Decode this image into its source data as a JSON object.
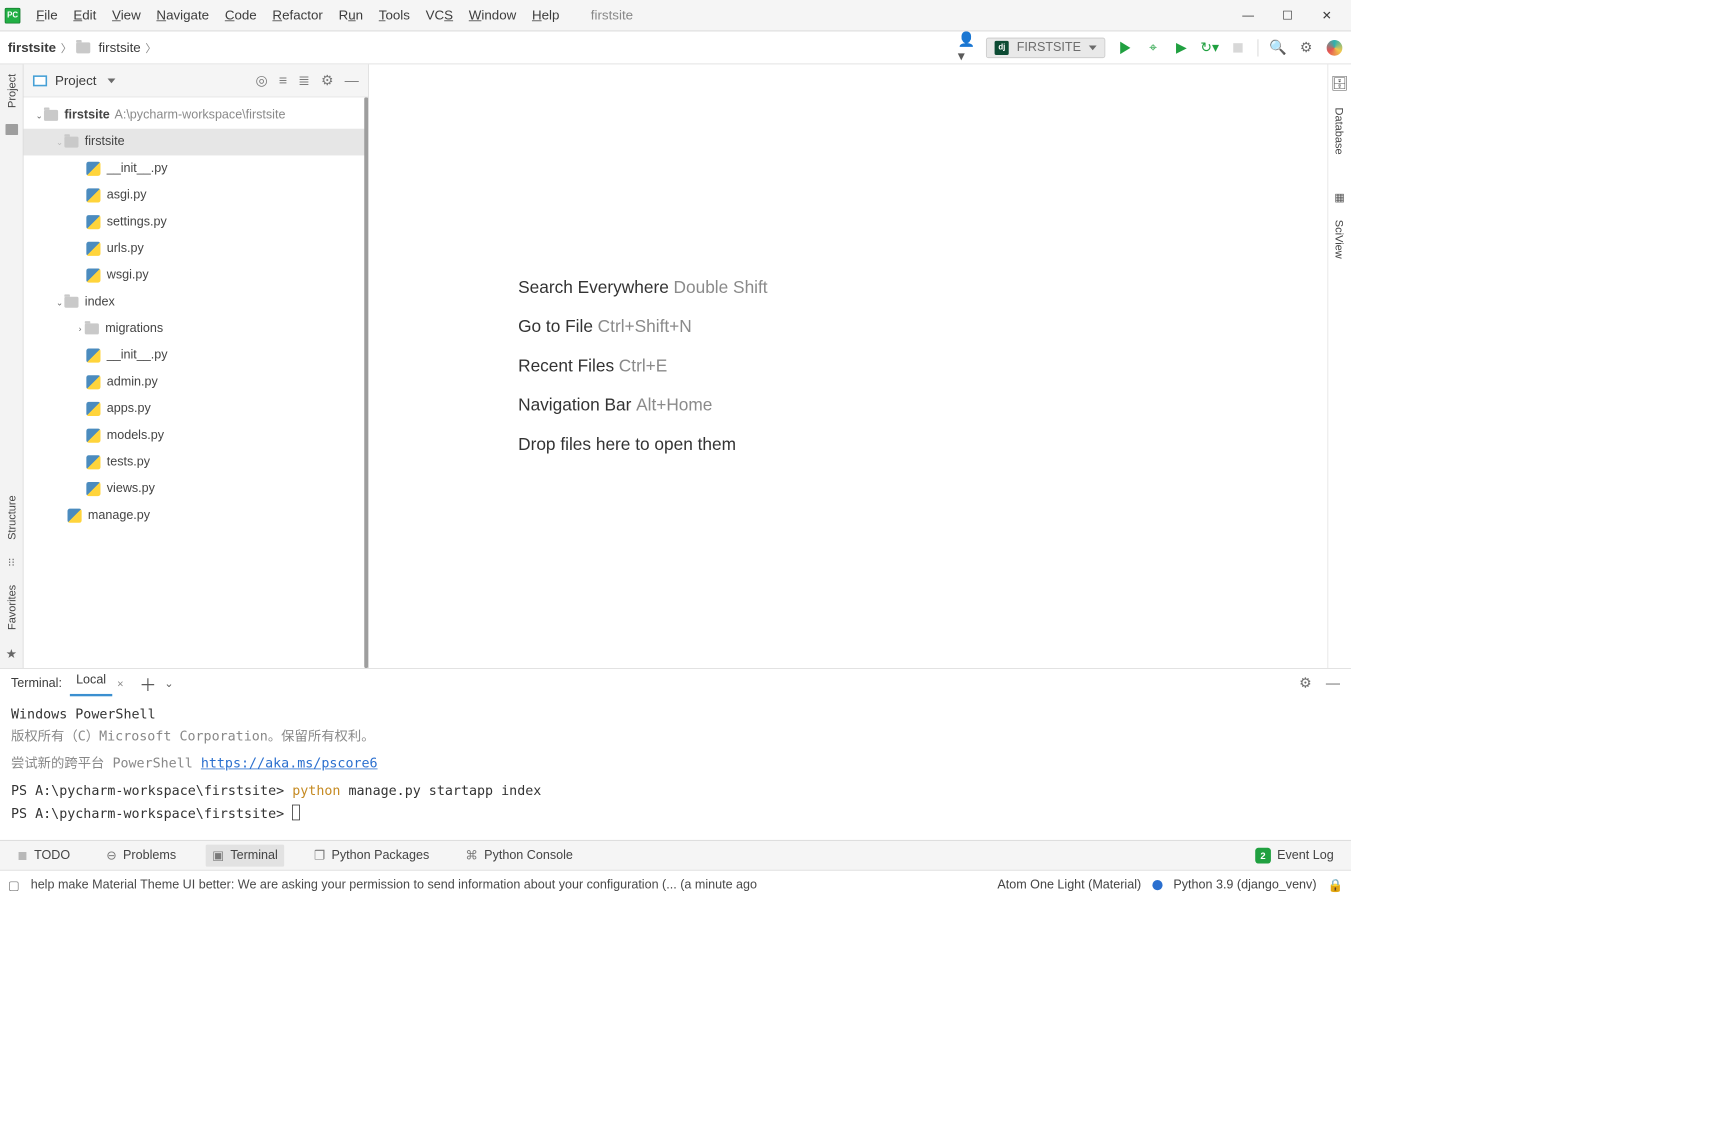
{
  "window": {
    "title": "firstsite"
  },
  "menu": {
    "file": "File",
    "edit": "Edit",
    "view": "View",
    "navigate": "Navigate",
    "code": "Code",
    "refactor": "Refactor",
    "run": "Run",
    "tools": "Tools",
    "vcs": "VCS",
    "window": "Window",
    "help": "Help"
  },
  "breadcrumbs": {
    "root": "firstsite",
    "child": "firstsite"
  },
  "runconfig": {
    "label": "FIRSTSITE"
  },
  "left_tabs": {
    "project": "Project"
  },
  "right_tabs": {
    "db": "Database",
    "sci": "SciView"
  },
  "lower_left_tabs": {
    "structure": "Structure",
    "favorites": "Favorites"
  },
  "project_header": {
    "label": "Project"
  },
  "tree": {
    "root": {
      "name": "firstsite",
      "path": "A:\\pycharm-workspace\\firstsite"
    },
    "inner": "firstsite",
    "inner_files": [
      "__init__.py",
      "asgi.py",
      "settings.py",
      "urls.py",
      "wsgi.py"
    ],
    "index": "index",
    "migrations": "migrations",
    "index_files": [
      "__init__.py",
      "admin.py",
      "apps.py",
      "models.py",
      "tests.py",
      "views.py"
    ],
    "manage": "manage.py"
  },
  "hints": {
    "h1": {
      "label": "Search Everywhere",
      "short": "Double Shift"
    },
    "h2": {
      "label": "Go to File",
      "short": "Ctrl+Shift+N"
    },
    "h3": {
      "label": "Recent Files",
      "short": "Ctrl+E"
    },
    "h4": {
      "label": "Navigation Bar",
      "short": "Alt+Home"
    },
    "drop": "Drop files here to open them"
  },
  "terminal": {
    "header": "Terminal:",
    "tab": "Local",
    "l1": "Windows PowerShell",
    "l2a": "版权所有（C）Microsoft Corporation。保留所有权利。",
    "l3a": "尝试新的跨平台 PowerShell ",
    "l3link": "https://aka.ms/pscore6",
    "prompt": "PS A:\\pycharm-workspace\\firstsite>",
    "cmd_py": "python",
    "cmd_rest": " manage.py startapp index"
  },
  "bottom": {
    "todo": "TODO",
    "problems": "Problems",
    "terminal": "Terminal",
    "pypkg": "Python Packages",
    "pycon": "Python Console",
    "eventlog": "Event Log",
    "badge": "2"
  },
  "status": {
    "msg": "help make Material Theme UI better: We are asking your permission to send information about your configuration (... (a minute ago",
    "theme": "Atom One Light (Material)",
    "python": "Python 3.9 (django_venv)"
  }
}
